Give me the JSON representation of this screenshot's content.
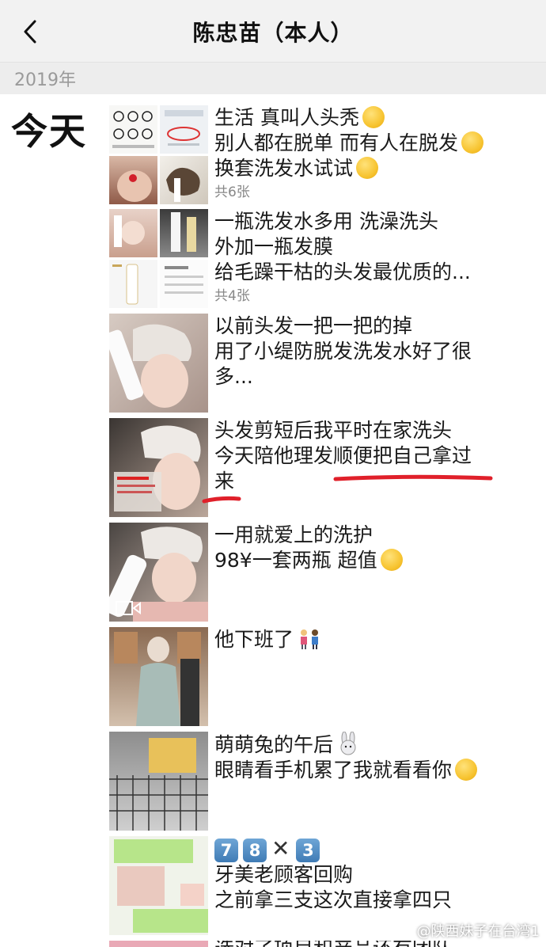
{
  "header": {
    "title": "陈忠苗（本人）"
  },
  "year": "2019年",
  "day": "今天",
  "posts": [
    {
      "lines": [
        "生活 真叫人头秃",
        "别人都在脱单 而有人在脱发",
        "换套洗发水试试"
      ],
      "emojis": [
        "shy-face-icon",
        "flushed-face-icon",
        "skeptical-face-icon"
      ],
      "count": "共6张"
    },
    {
      "lines": [
        "一瓶洗发水多用 洗澡洗头",
        "外加一瓶发膜",
        "给毛躁干枯的头发最优质的..."
      ],
      "count": "共4张"
    },
    {
      "lines": [
        "以前头发一把一把的掉",
        "用了小缇防脱发洗发水好了很",
        "多..."
      ]
    },
    {
      "lines": [
        "头发剪短后我平时在家洗头",
        "今天陪他理发顺便把自己拿过",
        "来"
      ]
    },
    {
      "lines": [
        "一用就爱上的洗护",
        "98¥一套两瓶 超值"
      ],
      "emojis": [
        "heart-eyes-face-icon"
      ]
    },
    {
      "lines": [
        "他下班了"
      ],
      "emojis": [
        "couple-icon"
      ]
    },
    {
      "lines": [
        "萌萌兔的午后",
        "眼睛看手机累了我就看看你"
      ],
      "emojis": [
        "rabbit-face-icon",
        "kissing-face-icon"
      ]
    },
    {
      "keys": [
        "7",
        "8",
        "3"
      ],
      "lines": [
        "牙美老顾客回购",
        "之前拿三支这次直接拿四只"
      ]
    },
    {
      "lines": [
        "选对了项目和产品还有团队"
      ]
    }
  ],
  "watermark": "@陕西妹子在台湾1",
  "colors": {
    "nav_bg": "#f2f2f2",
    "year_bg": "#ededed",
    "annotation_red": "#e0202a"
  }
}
